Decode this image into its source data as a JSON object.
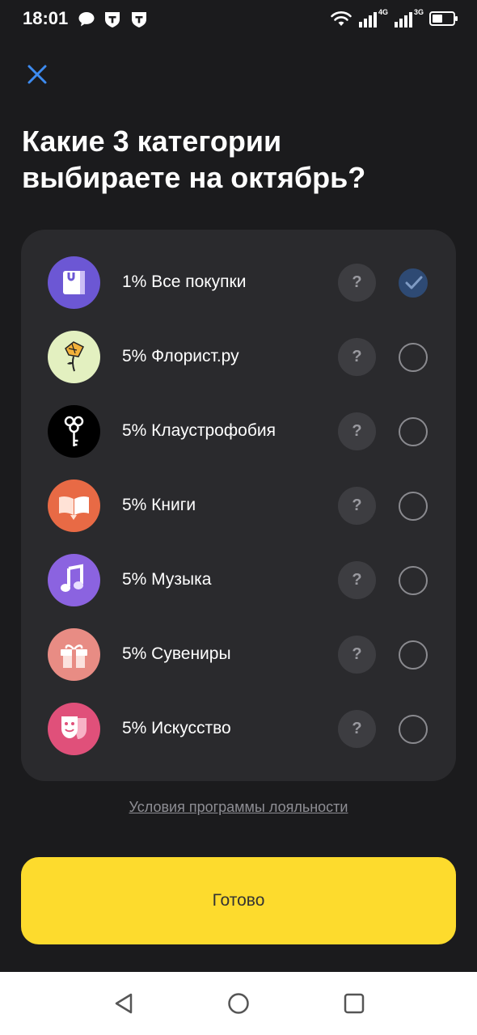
{
  "status_bar": {
    "time": "18:01",
    "network_1": "4G",
    "network_2": "3G",
    "icons": [
      "chat-bubble-icon",
      "tinkoff-shield-icon",
      "tinkoff-shield-icon",
      "wifi-icon",
      "signal-icon",
      "signal-icon",
      "battery-icon"
    ]
  },
  "header": {
    "title_line1": "Какие 3 категории",
    "title_line2": "выбираете на октябрь?"
  },
  "categories": [
    {
      "label": "1% Все покупки",
      "help": "?",
      "checked": true,
      "icon": "shopping-bag-icon",
      "color": "#6c57d4"
    },
    {
      "label": "5% Флорист.ру",
      "help": "?",
      "checked": false,
      "icon": "flower-icon",
      "color": "#e3f0c0"
    },
    {
      "label": "5% Клаустрофобия",
      "help": "?",
      "checked": false,
      "icon": "key-icon",
      "color": "#000000"
    },
    {
      "label": "5% Книги",
      "help": "?",
      "checked": false,
      "icon": "book-icon",
      "color": "#e86a45"
    },
    {
      "label": "5% Музыка",
      "help": "?",
      "checked": false,
      "icon": "music-note-icon",
      "color": "#8b63e0"
    },
    {
      "label": "5% Сувениры",
      "help": "?",
      "checked": false,
      "icon": "gift-icon",
      "color": "#e88c84"
    },
    {
      "label": "5% Искусство",
      "help": "?",
      "checked": false,
      "icon": "theater-mask-icon",
      "color": "#e0507a"
    }
  ],
  "terms_link": "Условия программы лояльности",
  "done_button": "Готово",
  "colors": {
    "background": "#1b1b1d",
    "card": "#2a2a2d",
    "accent_yellow": "#fddb2d",
    "close_blue": "#3d8bf0",
    "check_blue": "#2e4a74"
  }
}
